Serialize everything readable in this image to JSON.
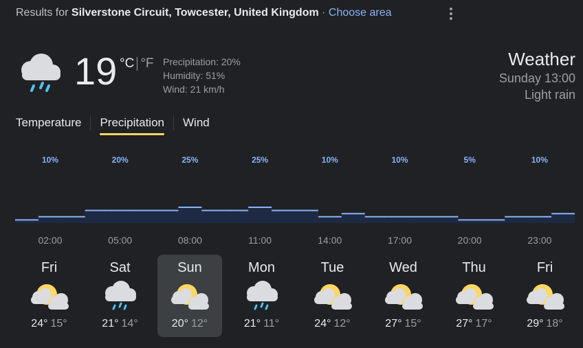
{
  "header": {
    "results_prefix": "Results for",
    "location": "Silverstone Circuit, Towcester, United Kingdom",
    "separator": "·",
    "choose_area": "Choose area"
  },
  "current": {
    "icon": "rain-cloud-icon",
    "temperature": "19",
    "unit_c": "°C",
    "unit_f": "°F",
    "precipitation": "Precipitation: 20%",
    "humidity": "Humidity: 51%",
    "wind": "Wind: 21 km/h"
  },
  "summary": {
    "title": "Weather",
    "time": "Sunday 13:00",
    "condition": "Light rain"
  },
  "tabs": [
    {
      "label": "Temperature",
      "active": false
    },
    {
      "label": "Precipitation",
      "active": true
    },
    {
      "label": "Wind",
      "active": false
    }
  ],
  "chart_data": {
    "type": "area",
    "metric": "precipitation",
    "x": [
      "02:00",
      "05:00",
      "08:00",
      "11:00",
      "14:00",
      "17:00",
      "20:00",
      "23:00"
    ],
    "values": [
      10,
      20,
      25,
      25,
      10,
      10,
      5,
      10
    ],
    "value_labels": [
      "10%",
      "20%",
      "25%",
      "25%",
      "10%",
      "10%",
      "5%",
      "10%"
    ],
    "hourly_values": [
      5,
      10,
      10,
      20,
      20,
      20,
      20,
      25,
      20,
      20,
      25,
      20,
      20,
      10,
      15,
      10,
      10,
      10,
      10,
      5,
      5,
      10,
      10,
      15
    ],
    "ylim": [
      0,
      100
    ],
    "colors": {
      "fill": "#1e2a44",
      "line": "#8ab4f8",
      "label": "#8ab4f8",
      "tick": "#9aa0a6"
    }
  },
  "forecast": [
    {
      "day": "Fri",
      "icon": "sun-cloud-icon",
      "high": "24°",
      "low": "15°",
      "selected": false
    },
    {
      "day": "Sat",
      "icon": "rain-cloud-icon",
      "high": "21°",
      "low": "14°",
      "selected": false
    },
    {
      "day": "Sun",
      "icon": "sun-cloud-icon",
      "high": "20°",
      "low": "12°",
      "selected": true
    },
    {
      "day": "Mon",
      "icon": "rain-cloud-icon",
      "high": "21°",
      "low": "11°",
      "selected": false
    },
    {
      "day": "Tue",
      "icon": "sun-cloud-icon",
      "high": "24°",
      "low": "12°",
      "selected": false
    },
    {
      "day": "Wed",
      "icon": "sun-cloud-icon",
      "high": "27°",
      "low": "15°",
      "selected": false
    },
    {
      "day": "Thu",
      "icon": "sun-cloud-icon",
      "high": "27°",
      "low": "17°",
      "selected": false
    },
    {
      "day": "Fri",
      "icon": "sun-cloud-icon",
      "high": "29°",
      "low": "18°",
      "selected": false
    }
  ]
}
